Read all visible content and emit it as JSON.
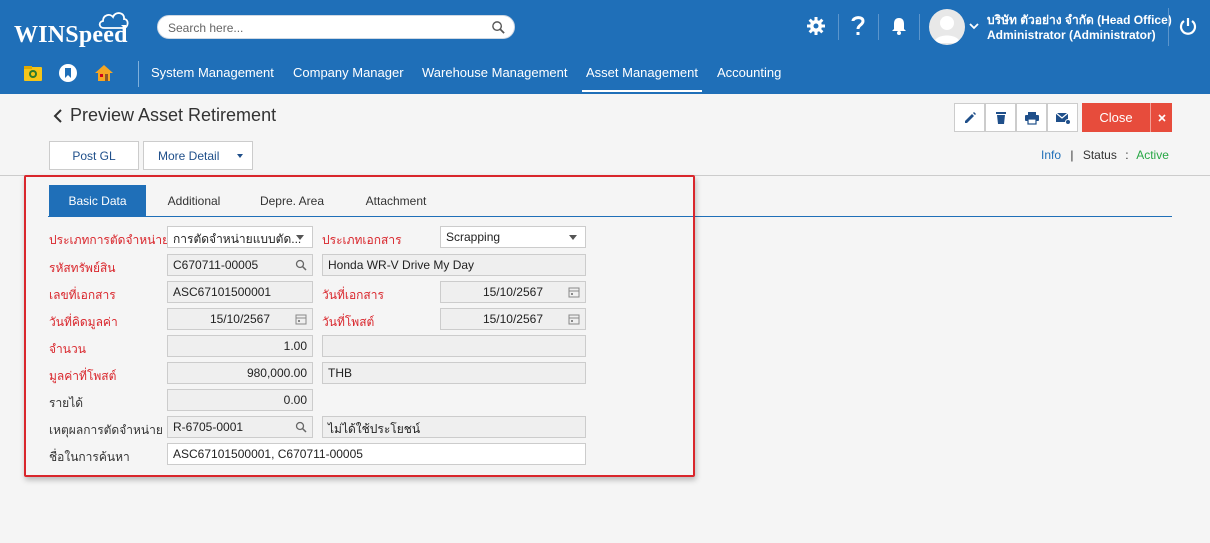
{
  "brand": {
    "name": "WINSpeed"
  },
  "search": {
    "placeholder": "Search here..."
  },
  "user": {
    "company": "บริษัท ตัวอย่าง จำกัด (Head Office)",
    "role": "Administrator (Administrator)"
  },
  "nav": {
    "items": [
      {
        "label": "System Management"
      },
      {
        "label": "Company Manager"
      },
      {
        "label": "Warehouse Management"
      },
      {
        "label": "Asset Management"
      },
      {
        "label": "Accounting"
      }
    ],
    "active": "Asset Management"
  },
  "page": {
    "title": "Preview Asset Retirement",
    "close_label": "Close",
    "post_gl_label": "Post GL",
    "more_detail_label": "More Detail",
    "info_label": "Info",
    "status_label": "Status",
    "status_sep": ":",
    "status_value": "Active",
    "divider": "|"
  },
  "tabs": [
    {
      "label": "Basic Data"
    },
    {
      "label": "Additional"
    },
    {
      "label": "Depre. Area"
    },
    {
      "label": "Attachment"
    }
  ],
  "form": {
    "disposal_type": {
      "label": "ประเภทการตัดจำหน่าย",
      "value": "การตัดจำหน่ายแบบตัด..."
    },
    "doc_type": {
      "label": "ประเภทเอกสาร",
      "value": "Scrapping"
    },
    "asset_code": {
      "label": "รหัสทรัพย์สิน",
      "value": "C670711-00005",
      "name": "Honda WR-V Drive My Day"
    },
    "doc_no": {
      "label": "เลขที่เอกสาร",
      "value": "ASC67101500001"
    },
    "doc_date": {
      "label": "วันที่เอกสาร",
      "value": "15/10/2567"
    },
    "calc_date": {
      "label": "วันที่คิดมูลค่า",
      "value": "15/10/2567"
    },
    "post_date": {
      "label": "วันที่โพสต์",
      "value": "15/10/2567"
    },
    "quantity": {
      "label": "จำนวน",
      "value": "1.00",
      "extra": ""
    },
    "post_value": {
      "label": "มูลค่าที่โพสต์",
      "value": "980,000.00",
      "currency": "THB"
    },
    "income": {
      "label": "รายได้",
      "value": "0.00"
    },
    "reason": {
      "label": "เหตุผลการตัดจำหน่าย",
      "code": "R-6705-0001",
      "desc": "ไม่ได้ใช้ประโยชน์"
    },
    "search_name": {
      "label": "ชื่อในการค้นหา",
      "value": "ASC67101500001, C670711-00005"
    }
  },
  "colors": {
    "header": "#1f6fb8",
    "required": "#d9262c",
    "close": "#e74c3c",
    "status": "#28a745"
  }
}
